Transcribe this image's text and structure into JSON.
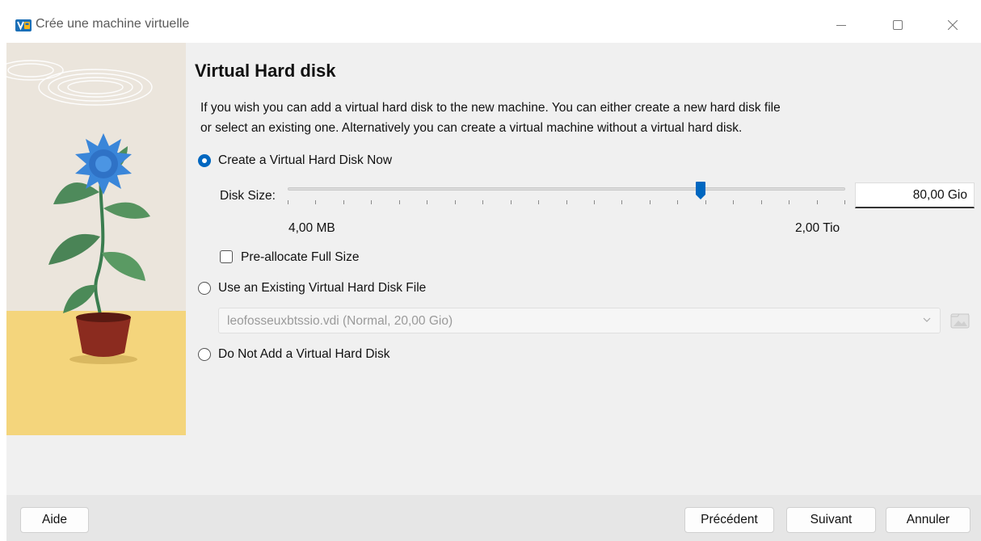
{
  "window": {
    "title": "Crée une machine virtuelle"
  },
  "page": {
    "heading": "Virtual Hard disk",
    "description_line1": "If you wish you can add a virtual hard disk to the new machine. You can either create a new hard disk file",
    "description_line2": "or select an existing one. Alternatively you can create a virtual machine without a virtual hard disk."
  },
  "options": {
    "create_new": {
      "label": "Create a Virtual Hard Disk Now",
      "selected": true
    },
    "use_existing": {
      "label": "Use an Existing Virtual Hard Disk File",
      "selected": false
    },
    "no_disk": {
      "label": "Do Not Add a Virtual Hard Disk",
      "selected": false
    }
  },
  "disk_size": {
    "label": "Disk Size:",
    "value": "80,00 Gio",
    "min_label": "4,00 MB",
    "max_label": "2,00 Tio",
    "slider_fraction": 0.74
  },
  "preallocate": {
    "label": "Pre-allocate Full Size",
    "checked": false
  },
  "existing_file": {
    "selected_value": "leofosseuxbtssio.vdi (Normal, 20,00 Gio)"
  },
  "buttons": {
    "help": "Aide",
    "previous": "Précédent",
    "next": "Suivant",
    "cancel": "Annuler"
  },
  "icons": {
    "app": "virtualbox-icon",
    "minimize": "minimize-icon",
    "maximize": "maximize-icon",
    "close": "close-icon",
    "dropdown": "chevron-down-icon",
    "folder": "folder-icon"
  },
  "colors": {
    "accent": "#0067c0",
    "illustration_floor": "#f4d57c"
  }
}
